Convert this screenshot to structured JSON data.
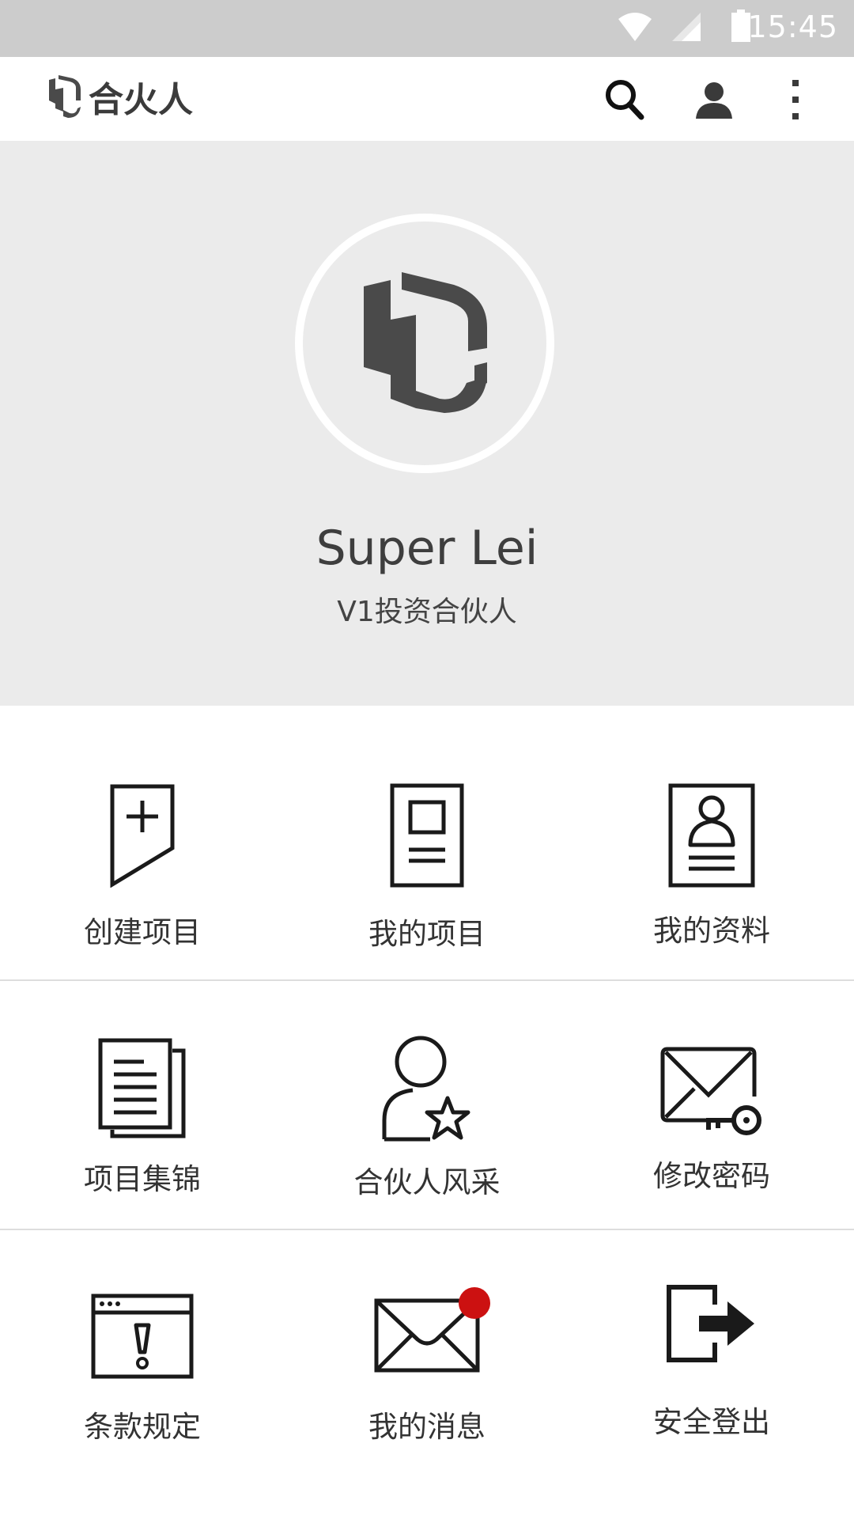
{
  "status_bar": {
    "time": "15:45",
    "icons": [
      "wifi-icon",
      "cell-signal-icon",
      "battery-icon"
    ]
  },
  "app_bar": {
    "title": "合火人",
    "actions": [
      "search-icon",
      "account-icon",
      "more-vert-icon"
    ]
  },
  "profile": {
    "name": "Super Lei",
    "role": "V1投资合伙人"
  },
  "menu": {
    "create_project": "创建项目",
    "my_projects": "我的项目",
    "my_profile": "我的资料",
    "project_showcase": "项目集锦",
    "partner_showcase": "合伙人风采",
    "change_password": "修改密码",
    "terms": "条款规定",
    "my_messages": "我的消息",
    "logout": "安全登出"
  },
  "colors": {
    "status_bar": "#cccccc",
    "profile_bg": "#ebebeb",
    "icon": "#1a1a1a",
    "badge": "#cc1111",
    "logo": "#4a4a4a"
  }
}
